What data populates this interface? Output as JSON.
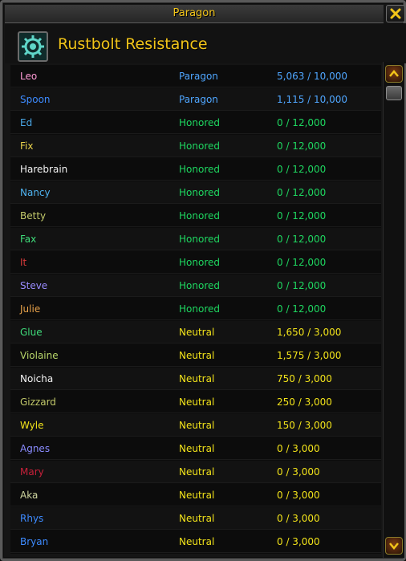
{
  "window": {
    "title": "Paragon"
  },
  "faction": {
    "name": "Rustbolt Resistance",
    "icon": "rustbolt-gear-icon"
  },
  "close": {
    "icon": "close-icon"
  },
  "scrollbar": {
    "up_icon": "scroll-up-arrow-icon",
    "down_icon": "scroll-down-arrow-icon"
  },
  "rows": [
    {
      "name": "Leo",
      "standing": "Paragon",
      "value": "5,063 / 10,000",
      "name_color": "#ff9bd6",
      "standing_color": "#4fa6ff",
      "value_color": "#4fa6ff"
    },
    {
      "name": "Spoon",
      "standing": "Paragon",
      "value": "1,115 / 10,000",
      "name_color": "#3d8bff",
      "standing_color": "#4fa6ff",
      "value_color": "#4fa6ff"
    },
    {
      "name": "Ed",
      "standing": "Honored",
      "value": "0 / 12,000",
      "name_color": "#4aa8e8",
      "standing_color": "#1ed760",
      "value_color": "#1ed760"
    },
    {
      "name": "Fix",
      "standing": "Honored",
      "value": "0 / 12,000",
      "name_color": "#e8d14a",
      "standing_color": "#1ed760",
      "value_color": "#1ed760"
    },
    {
      "name": "Harebrain",
      "standing": "Honored",
      "value": "0 / 12,000",
      "name_color": "#f2f2f2",
      "standing_color": "#1ed760",
      "value_color": "#1ed760"
    },
    {
      "name": "Nancy",
      "standing": "Honored",
      "value": "0 / 12,000",
      "name_color": "#4fb3f0",
      "standing_color": "#1ed760",
      "value_color": "#1ed760"
    },
    {
      "name": "Betty",
      "standing": "Honored",
      "value": "0 / 12,000",
      "name_color": "#c2c96a",
      "standing_color": "#1ed760",
      "value_color": "#1ed760"
    },
    {
      "name": "Fax",
      "standing": "Honored",
      "value": "0 / 12,000",
      "name_color": "#3fdc7a",
      "standing_color": "#1ed760",
      "value_color": "#1ed760"
    },
    {
      "name": "It",
      "standing": "Honored",
      "value": "0 / 12,000",
      "name_color": "#d83a3a",
      "standing_color": "#1ed760",
      "value_color": "#1ed760"
    },
    {
      "name": "Steve",
      "standing": "Honored",
      "value": "0 / 12,000",
      "name_color": "#9a8cff",
      "standing_color": "#1ed760",
      "value_color": "#1ed760"
    },
    {
      "name": "Julie",
      "standing": "Honored",
      "value": "0 / 12,000",
      "name_color": "#e8a24a",
      "standing_color": "#1ed760",
      "value_color": "#1ed760"
    },
    {
      "name": "Glue",
      "standing": "Neutral",
      "value": "1,650 / 3,000",
      "name_color": "#3fdc7a",
      "standing_color": "#f2e31a",
      "value_color": "#f2e31a"
    },
    {
      "name": "Violaine",
      "standing": "Neutral",
      "value": "1,575 / 3,000",
      "name_color": "#b8d66a",
      "standing_color": "#f2e31a",
      "value_color": "#f2e31a"
    },
    {
      "name": "Noicha",
      "standing": "Neutral",
      "value": "750 / 3,000",
      "name_color": "#f2f2f2",
      "standing_color": "#f2e31a",
      "value_color": "#f2e31a"
    },
    {
      "name": "Gizzard",
      "standing": "Neutral",
      "value": "250 / 3,000",
      "name_color": "#c2c96a",
      "standing_color": "#f2e31a",
      "value_color": "#f2e31a"
    },
    {
      "name": "Wyle",
      "standing": "Neutral",
      "value": "150 / 3,000",
      "name_color": "#f2e31a",
      "standing_color": "#f2e31a",
      "value_color": "#f2e31a"
    },
    {
      "name": "Agnes",
      "standing": "Neutral",
      "value": "0 / 3,000",
      "name_color": "#8a8cff",
      "standing_color": "#f2e31a",
      "value_color": "#f2e31a"
    },
    {
      "name": "Mary",
      "standing": "Neutral",
      "value": "0 / 3,000",
      "name_color": "#c8203a",
      "standing_color": "#f2e31a",
      "value_color": "#f2e31a"
    },
    {
      "name": "Aka",
      "standing": "Neutral",
      "value": "0 / 3,000",
      "name_color": "#cfd6a0",
      "standing_color": "#f2e31a",
      "value_color": "#f2e31a"
    },
    {
      "name": "Rhys",
      "standing": "Neutral",
      "value": "0 / 3,000",
      "name_color": "#3d8bff",
      "standing_color": "#f2e31a",
      "value_color": "#f2e31a"
    },
    {
      "name": "Bryan",
      "standing": "Neutral",
      "value": "0 / 3,000",
      "name_color": "#3d8bff",
      "standing_color": "#f2e31a",
      "value_color": "#f2e31a"
    }
  ]
}
